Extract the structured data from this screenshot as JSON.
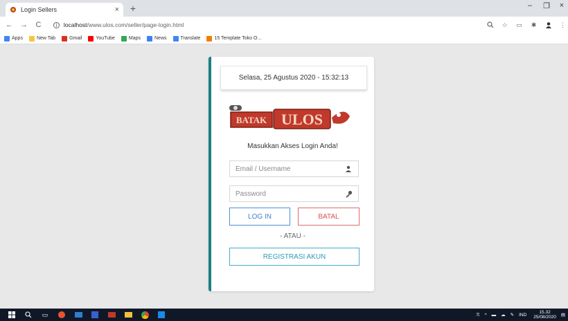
{
  "browser": {
    "tab_title": "Login Sellers",
    "tab_close": "×",
    "new_tab": "+",
    "window_controls": {
      "minimize": "–",
      "maximize": "❐",
      "close": "×"
    },
    "url_host": "localhost",
    "url_path": "/www.ulos.com/seller/page-login.html",
    "nav": {
      "back": "←",
      "forward": "→",
      "reload": "C"
    }
  },
  "bookmarks": [
    {
      "label": "Apps",
      "color": "#4285f4"
    },
    {
      "label": "New Tab",
      "color": "#f4c542"
    },
    {
      "label": "Gmail",
      "color": "#d93025"
    },
    {
      "label": "YouTube",
      "color": "#ff0000"
    },
    {
      "label": "Maps",
      "color": "#34a853"
    },
    {
      "label": "News",
      "color": "#3b82f6"
    },
    {
      "label": "Translate",
      "color": "#4285f4"
    },
    {
      "label": "15 Template Toko O...",
      "color": "#f57c00"
    }
  ],
  "login": {
    "datetime": "Selasa, 25 Agustus 2020 - 15:32:13",
    "logo_text": "BATAK ULOS",
    "subtitle": "Masukkan Akses Login Anda!",
    "email_placeholder": "Email / Username",
    "password_placeholder": "Password",
    "login_button": "LOG IN",
    "cancel_button": "BATAL",
    "or_text": "- ATAU -",
    "register_button": "REGISTRASI AKUN"
  },
  "colors": {
    "accent_bar": "#1e7f82",
    "login_blue": "#3f7fd0",
    "cancel_red": "#d9534f",
    "register_teal": "#2f9bb8"
  },
  "taskbar": {
    "language": "IND",
    "time": "15.32",
    "date": "25/08/2020"
  }
}
